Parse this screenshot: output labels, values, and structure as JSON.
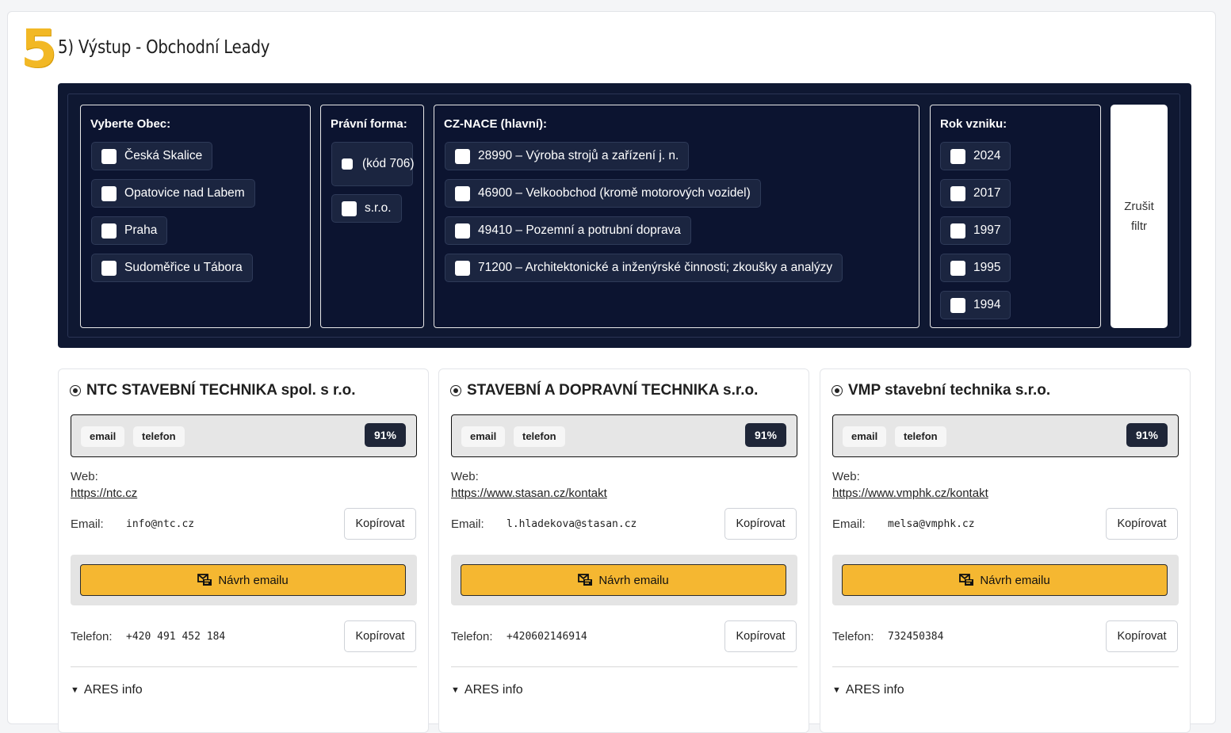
{
  "section": {
    "number": "5",
    "title": "5) Výstup - Obchodní Leady"
  },
  "filters": {
    "obec": {
      "title": "Vyberte Obec:",
      "options": [
        "Česká Skalice",
        "Opatovice nad Labem",
        "Praha",
        "Sudoměřice u Tábora"
      ]
    },
    "pravni_forma": {
      "title": "Právní forma:",
      "options": [
        "(kód 706)",
        "s.r.o."
      ]
    },
    "nace": {
      "title": "CZ-NACE (hlavní):",
      "options": [
        "28990 – Výroba strojů a zařízení j. n.",
        "46900 – Velkoobchod (kromě motorových vozidel)",
        "49410 – Pozemní a potrubní doprava",
        "71200 – Architektonické a inženýrské činnosti; zkoušky a analýzy"
      ]
    },
    "rok": {
      "title": "Rok vzniku:",
      "options": [
        "2024",
        "2017",
        "1997",
        "1995",
        "1994"
      ]
    },
    "reset_label_line1": "Zrušit",
    "reset_label_line2": "filtr"
  },
  "labels": {
    "web": "Web:",
    "email": "Email:",
    "phone": "Telefon:",
    "copy": "Kopírovat",
    "suggest": "Návrh emailu",
    "ares": "ARES info"
  },
  "cards": [
    {
      "name": "NTC STAVEBNÍ TECHNIKA spol. s r.o.",
      "tags": [
        "email",
        "telefon"
      ],
      "score": "91%",
      "web": "https://ntc.cz",
      "email": "info@ntc.cz",
      "phone": "+420 491 452 184"
    },
    {
      "name": "STAVEBNÍ A DOPRAVNÍ TECHNIKA s.r.o.",
      "tags": [
        "email",
        "telefon"
      ],
      "score": "91%",
      "web": "https://www.stasan.cz/kontakt",
      "email": "l.hladekova@stasan.cz",
      "phone": "+420602146914"
    },
    {
      "name": "VMP stavební technika s.r.o.",
      "tags": [
        "email",
        "telefon"
      ],
      "score": "91%",
      "web": "https://www.vmphk.cz/kontakt",
      "email": "melsa@vmphk.cz",
      "phone": "732450384"
    }
  ],
  "colors": {
    "accent": "#f5b731",
    "filter_panel": "#0f1832",
    "score_badge": "#1f2638"
  }
}
